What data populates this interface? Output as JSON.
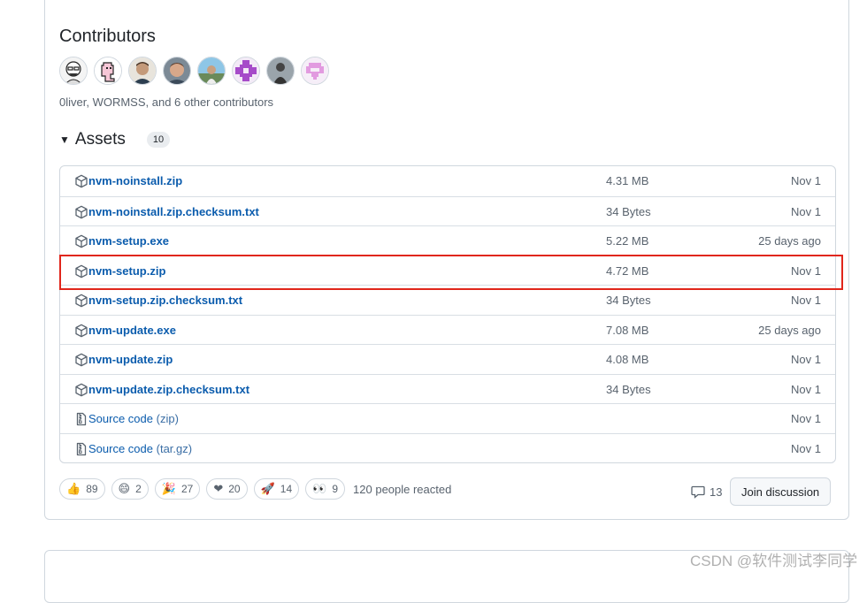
{
  "contributors": {
    "title": "Contributors",
    "avatars": [
      "avatar-1",
      "avatar-2",
      "avatar-3",
      "avatar-4",
      "avatar-5",
      "avatar-6",
      "avatar-7",
      "avatar-8"
    ],
    "summary": "0liver, WORMSS, and 6 other contributors"
  },
  "assets": {
    "title": "Assets",
    "count": "10",
    "rows": [
      {
        "name": "nvm-noinstall.zip",
        "size": "4.31 MB",
        "date": "Nov 1",
        "icon": "package-icon"
      },
      {
        "name": "nvm-noinstall.zip.checksum.txt",
        "size": "34 Bytes",
        "date": "Nov 1",
        "icon": "package-icon"
      },
      {
        "name": "nvm-setup.exe",
        "size": "5.22 MB",
        "date": "25 days ago",
        "icon": "package-icon"
      },
      {
        "name": "nvm-setup.zip",
        "size": "4.72 MB",
        "date": "Nov 1",
        "icon": "package-icon"
      },
      {
        "name": "nvm-setup.zip.checksum.txt",
        "size": "34 Bytes",
        "date": "Nov 1",
        "icon": "package-icon"
      },
      {
        "name": "nvm-update.exe",
        "size": "7.08 MB",
        "date": "25 days ago",
        "icon": "package-icon"
      },
      {
        "name": "nvm-update.zip",
        "size": "4.08 MB",
        "date": "Nov 1",
        "icon": "package-icon"
      },
      {
        "name": "nvm-update.zip.checksum.txt",
        "size": "34 Bytes",
        "date": "Nov 1",
        "icon": "package-icon"
      }
    ],
    "source_rows": [
      {
        "name": "Source code",
        "suffix": "(zip)",
        "date": "Nov 1",
        "icon": "file-zip-icon"
      },
      {
        "name": "Source code",
        "suffix": "(tar.gz)",
        "date": "Nov 1",
        "icon": "file-zip-icon"
      }
    ]
  },
  "reactions": {
    "items": [
      {
        "emoji": "👍",
        "icon": "thumbs-up-icon",
        "count": "89"
      },
      {
        "emoji": "😄",
        "icon": "smile-icon",
        "count": "2"
      },
      {
        "emoji": "🎉",
        "icon": "tada-icon",
        "count": "27"
      },
      {
        "emoji": "❤",
        "icon": "heart-icon",
        "count": "20"
      },
      {
        "emoji": "🚀",
        "icon": "rocket-icon",
        "count": "14"
      },
      {
        "emoji": "👀",
        "icon": "eyes-icon",
        "count": "9"
      }
    ],
    "summary": "120 people reacted"
  },
  "discussion": {
    "comment_count": "13",
    "join_label": "Join discussion"
  },
  "watermark": "CSDN @软件测试李同学",
  "colors": {
    "link": "#0b5cad",
    "highlight": "#e0261b",
    "border": "#d0d7de",
    "muted": "#59636e"
  }
}
